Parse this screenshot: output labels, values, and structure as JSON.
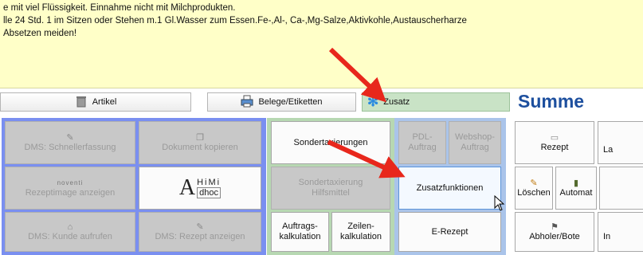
{
  "notice": {
    "line1": "e mit viel Flüssigkeit. Einnahme nicht mit Milchprodukten.",
    "line2": "lle 24 Std. 1 im Sitzen oder Stehen m.1 Gl.Wasser zum Essen.Fe-,Al-, Ca-,Mg-Salze,Aktivkohle,Austauscherharze",
    "line3": "Absetzen meiden!"
  },
  "tabs": [
    {
      "label": "Artikel",
      "icon": "trash-bin-icon"
    },
    {
      "label": "Belege/Etiketten",
      "icon": "printer-icon"
    },
    {
      "label": "Zusatz",
      "icon": "snowflake-icon"
    }
  ],
  "summe": "Summe",
  "blue_panel": {
    "dms_schnellerfassung": "DMS: Schnellerfassung",
    "dokument_kopieren": "Dokument kopieren",
    "rezeptimage_anzeigen": "Rezeptimage anzeigen",
    "rezeptimage_logo": "noventi",
    "ahimi_big": "A",
    "ahimi_top": "HiMi",
    "ahimi_bottom": "dhoc",
    "dms_kunde_aufrufen": "DMS: Kunde aufrufen",
    "dms_rezept_anzeigen": "DMS: Rezept anzeigen"
  },
  "green_panel": {
    "sondertaxierungen": "Sondertaxierungen",
    "sondertaxierung_hilfsmittel_1": "Sondertaxierung",
    "sondertaxierung_hilfsmittel_2": "Hilfsmittel",
    "auftragskalkulation_1": "Auftrags-",
    "auftragskalkulation_2": "kalkulation",
    "zeilenkalkulation_1": "Zeilen-",
    "zeilenkalkulation_2": "kalkulation"
  },
  "lblue_panel": {
    "pdl_1": "PDL-",
    "pdl_2": "Auftrag",
    "webshop_1": "Webshop-",
    "webshop_2": "Auftrag",
    "zusatzfunktionen": "Zusatzfunktionen",
    "erezept": "E-Rezept"
  },
  "right_panel": {
    "rezept": "Rezept",
    "la": "La",
    "loeschen": "Löschen",
    "automat": "Automat",
    "abholer_bote": "Abholer/Bote",
    "in": "In"
  },
  "colors": {
    "arrow": "#e8271c",
    "notice_bg": "#ffffc8",
    "blue_panel": "#7a8ff0",
    "green_panel": "#b7d8b2",
    "lblue_panel": "#aac4ea",
    "summe_text": "#1d4f9e"
  }
}
